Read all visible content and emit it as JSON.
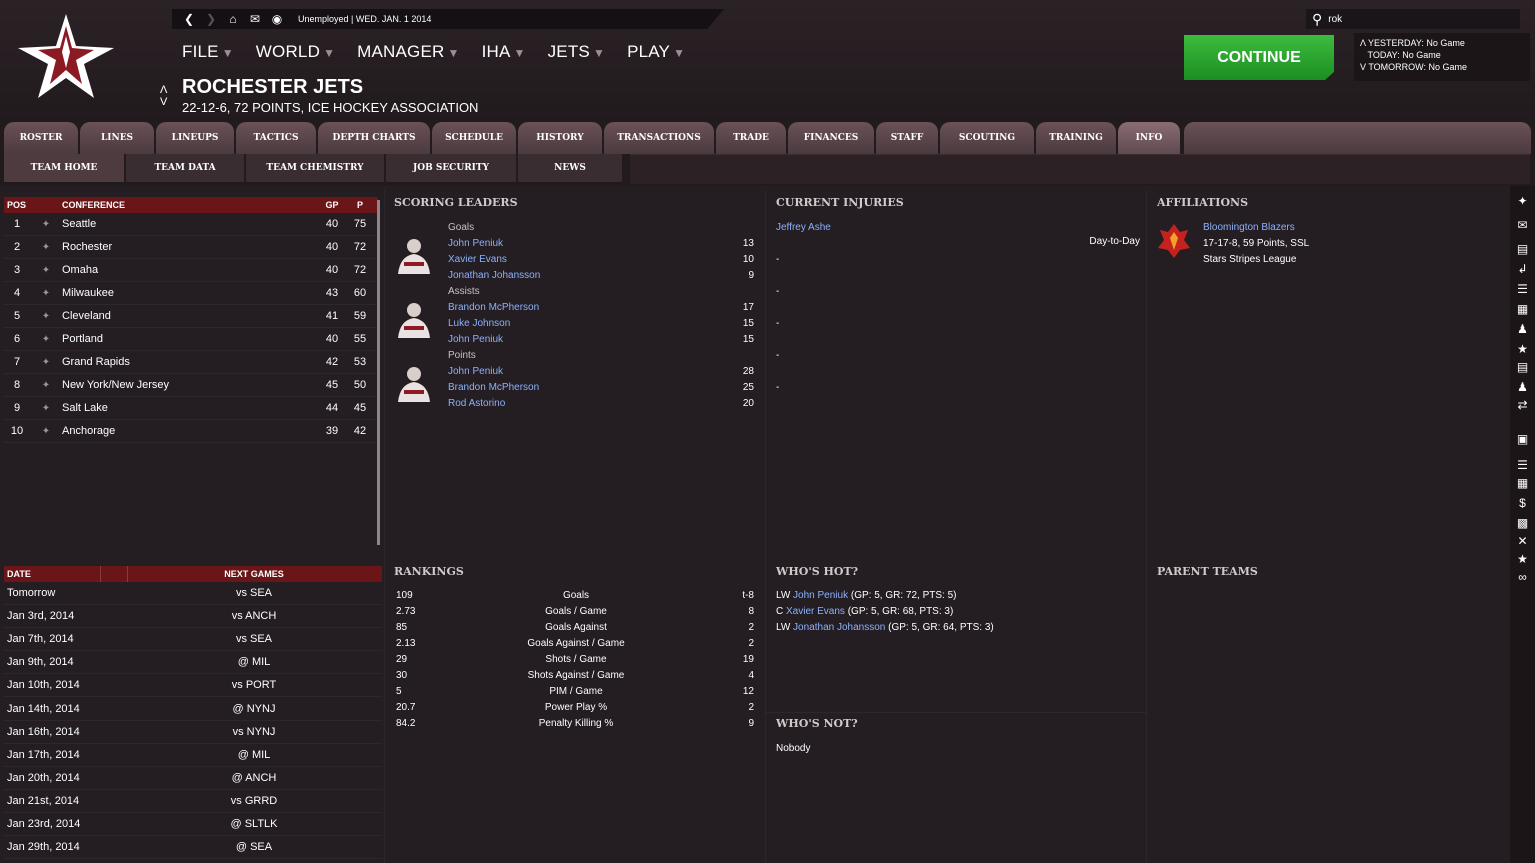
{
  "topbar": {
    "status": "Unemployed | WED. JAN. 1 2014"
  },
  "menus": [
    {
      "label": "FILE"
    },
    {
      "label": "WORLD"
    },
    {
      "label": "MANAGER"
    },
    {
      "label": "IHA"
    },
    {
      "label": "JETS"
    },
    {
      "label": "PLAY"
    }
  ],
  "team": {
    "name": "ROCHESTER JETS",
    "record": "22-12-6, 72 POINTS, ICE HOCKEY ASSOCIATION"
  },
  "search": {
    "value": "rok"
  },
  "continue_label": "CONTINUE",
  "schedule_box": {
    "yesterday": "YESTERDAY: No Game",
    "today": "TODAY: No Game",
    "tomorrow": "TOMORROW: No Game"
  },
  "tabs": [
    "ROSTER",
    "LINES",
    "LINEUPS",
    "TACTICS",
    "DEPTH CHARTS",
    "SCHEDULE",
    "HISTORY",
    "TRANSACTIONS",
    "TRADE",
    "FINANCES",
    "STAFF",
    "SCOUTING",
    "TRAINING",
    "INFO"
  ],
  "subtabs": [
    "TEAM HOME",
    "TEAM DATA",
    "TEAM CHEMISTRY",
    "JOB SECURITY",
    "NEWS"
  ],
  "standings": {
    "headers": {
      "pos": "POS",
      "conf": "CONFERENCE",
      "gp": "GP",
      "p": "P"
    },
    "rows": [
      {
        "pos": "1",
        "team": "Seattle",
        "gp": "40",
        "p": "75"
      },
      {
        "pos": "2",
        "team": "Rochester",
        "gp": "40",
        "p": "72"
      },
      {
        "pos": "3",
        "team": "Omaha",
        "gp": "40",
        "p": "72"
      },
      {
        "pos": "4",
        "team": "Milwaukee",
        "gp": "43",
        "p": "60"
      },
      {
        "pos": "5",
        "team": "Cleveland",
        "gp": "41",
        "p": "59"
      },
      {
        "pos": "6",
        "team": "Portland",
        "gp": "40",
        "p": "55"
      },
      {
        "pos": "7",
        "team": "Grand Rapids",
        "gp": "42",
        "p": "53"
      },
      {
        "pos": "8",
        "team": "New York/New Jersey",
        "gp": "45",
        "p": "50"
      },
      {
        "pos": "9",
        "team": "Salt Lake",
        "gp": "44",
        "p": "45"
      },
      {
        "pos": "10",
        "team": "Anchorage",
        "gp": "39",
        "p": "42"
      }
    ]
  },
  "next_games": {
    "headers": {
      "date": "DATE",
      "next": "NEXT GAMES"
    },
    "rows": [
      {
        "date": "Tomorrow",
        "opp": "vs SEA"
      },
      {
        "date": "Jan 3rd, 2014",
        "opp": "vs ANCH"
      },
      {
        "date": "Jan 7th, 2014",
        "opp": "vs SEA"
      },
      {
        "date": "Jan 9th, 2014",
        "opp": "@ MIL"
      },
      {
        "date": "Jan 10th, 2014",
        "opp": "vs PORT"
      },
      {
        "date": "Jan 14th, 2014",
        "opp": "@ NYNJ"
      },
      {
        "date": "Jan 16th, 2014",
        "opp": "vs NYNJ"
      },
      {
        "date": "Jan 17th, 2014",
        "opp": "@ MIL"
      },
      {
        "date": "Jan 20th, 2014",
        "opp": "@ ANCH"
      },
      {
        "date": "Jan 21st, 2014",
        "opp": "vs GRRD"
      },
      {
        "date": "Jan 23rd, 2014",
        "opp": "@ SLTLK"
      },
      {
        "date": "Jan 29th, 2014",
        "opp": "@ SEA"
      }
    ]
  },
  "scoring_leaders": {
    "title": "SCORING LEADERS",
    "groups": [
      {
        "category": "Goals",
        "players": [
          {
            "name": "John Peniuk",
            "value": "13"
          },
          {
            "name": "Xavier Evans",
            "value": "10"
          },
          {
            "name": "Jonathan Johansson",
            "value": "9"
          }
        ]
      },
      {
        "category": "Assists",
        "players": [
          {
            "name": "Brandon McPherson",
            "value": "17"
          },
          {
            "name": "Luke Johnson",
            "value": "15"
          },
          {
            "name": "John Peniuk",
            "value": "15"
          }
        ]
      },
      {
        "category": "Points",
        "players": [
          {
            "name": "John Peniuk",
            "value": "28"
          },
          {
            "name": "Brandon McPherson",
            "value": "25"
          },
          {
            "name": "Rod Astorino",
            "value": "20"
          }
        ]
      }
    ]
  },
  "injuries": {
    "title": "CURRENT INJURIES",
    "player": "Jeffrey Ashe",
    "status": "Day-to-Day",
    "dashes": [
      "-",
      "-",
      "-",
      "-",
      "-"
    ]
  },
  "affiliations": {
    "title": "AFFILIATIONS",
    "team": "Bloomington Blazers",
    "record": "17-17-8, 59 Points, SSL",
    "league": "Stars Stripes League"
  },
  "rankings": {
    "title": "RANKINGS",
    "rows": [
      {
        "value": "109",
        "label": "Goals",
        "rank": "t-8"
      },
      {
        "value": "2.73",
        "label": "Goals / Game",
        "rank": "8"
      },
      {
        "value": "85",
        "label": "Goals Against",
        "rank": "2"
      },
      {
        "value": "2.13",
        "label": "Goals Against / Game",
        "rank": "2"
      },
      {
        "value": "29",
        "label": "Shots / Game",
        "rank": "19"
      },
      {
        "value": "30",
        "label": "Shots Against / Game",
        "rank": "4"
      },
      {
        "value": "5",
        "label": "PIM / Game",
        "rank": "12"
      },
      {
        "value": "20.7",
        "label": "Power Play %",
        "rank": "2"
      },
      {
        "value": "84.2",
        "label": "Penalty Killing %",
        "rank": "9"
      }
    ]
  },
  "whos_hot": {
    "title": "WHO'S HOT?",
    "rows": [
      {
        "pos": "LW",
        "name": "John Peniuk",
        "stats": "(GP: 5, GR: 72, PTS: 5)"
      },
      {
        "pos": "C",
        "name": "Xavier Evans",
        "stats": "(GP: 5, GR: 68, PTS: 3)"
      },
      {
        "pos": "LW",
        "name": "Jonathan Johansson",
        "stats": "(GP: 5, GR: 64, PTS: 3)"
      }
    ]
  },
  "whos_not": {
    "title": "WHO'S NOT?",
    "text": "Nobody"
  },
  "parent_teams": {
    "title": "PARENT TEAMS"
  },
  "colors": {
    "accent_red": "#6a1518",
    "continue_green": "#2aa32f",
    "link_blue": "#8ab2ff"
  }
}
